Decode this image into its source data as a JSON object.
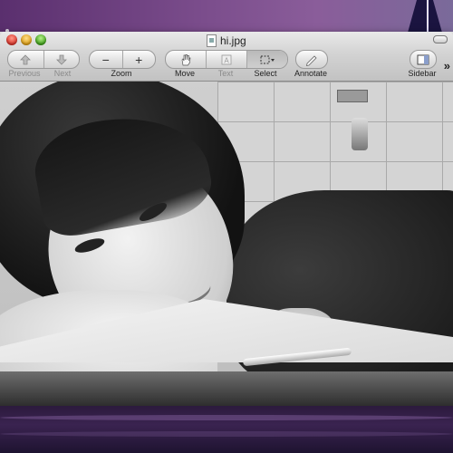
{
  "window": {
    "title": "hi.jpg",
    "toolbar": {
      "previous_label": "Previous",
      "next_label": "Next",
      "zoom_label": "Zoom",
      "zoom_out_glyph": "−",
      "zoom_in_glyph": "+",
      "move_label": "Move",
      "text_label": "Text",
      "select_label": "Select",
      "annotate_label": "Annotate",
      "sidebar_label": "Sidebar",
      "overflow_glyph": "»"
    }
  },
  "icons": {
    "previous": "arrow-up-icon",
    "next": "arrow-down-icon",
    "move": "hand-icon",
    "text": "text-cursor-icon",
    "select": "marquee-select-icon",
    "annotate": "pencil-icon",
    "sidebar": "sidebar-icon"
  },
  "colors": {
    "close": "#d8332a",
    "minimize": "#d99a12",
    "zoom": "#3e9e1a"
  }
}
